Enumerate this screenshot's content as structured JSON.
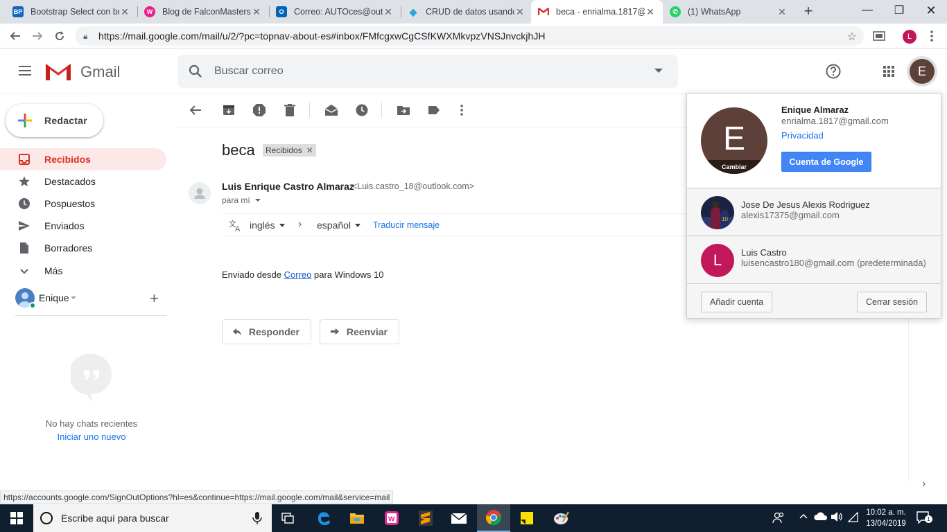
{
  "browser": {
    "tabs": [
      {
        "title": "Bootstrap Select con bu",
        "favicon": "BP",
        "favicon_color": "#1565c0"
      },
      {
        "title": "Blog de FalconMasters",
        "favicon": "W",
        "favicon_color": "#e91e8c"
      },
      {
        "title": "Correo: AUTOces@outl",
        "favicon": "O",
        "favicon_color": "#0364b8"
      },
      {
        "title": "CRUD de datos usando",
        "favicon": "◆",
        "favicon_color": "#29a9d8"
      },
      {
        "title": "beca - enrialma.1817@",
        "favicon": "M",
        "favicon_color": "#ffffff",
        "active": true
      },
      {
        "title": "(1) WhatsApp",
        "favicon": "✆",
        "favicon_color": "#25d366"
      }
    ],
    "url": "https://mail.google.com/mail/u/2/?pc=topnav-about-es#inbox/FMfcgxwCgCSfKWXMkvpzVNSJnvckjhJH",
    "profile_initial": "L",
    "status_url": "https://accounts.google.com/SignOutOptions?hl=es&continue=https://mail.google.com/mail&service=mail"
  },
  "gmail": {
    "brand": "Gmail",
    "search_placeholder": "Buscar correo",
    "user_initial": "E",
    "compose_label": "Redactar",
    "nav": [
      {
        "label": "Recibidos",
        "icon": "inbox-icon",
        "active": true
      },
      {
        "label": "Destacados",
        "icon": "star-icon"
      },
      {
        "label": "Pospuestos",
        "icon": "clock-icon"
      },
      {
        "label": "Enviados",
        "icon": "send-icon"
      },
      {
        "label": "Borradores",
        "icon": "draft-icon"
      },
      {
        "label": "Más",
        "icon": "chevron-down-icon"
      }
    ],
    "hangouts": {
      "user": "Enique",
      "no_chats": "No hay chats recientes",
      "start_new": "Iniciar uno nuevo"
    }
  },
  "message": {
    "subject": "beca",
    "label": "Recibidos",
    "sender_name": "Luis Enrique Castro Almaraz",
    "sender_email": "<Luis.castro_18@outlook.com>",
    "to": "para mí",
    "translate": {
      "from": "inglés",
      "to": "español",
      "action": "Traducir mensaje"
    },
    "body_prefix": "Enviado desde ",
    "body_link": "Correo",
    "body_suffix": " para Windows 10",
    "reply_label": "Responder",
    "forward_label": "Reenviar"
  },
  "account_popup": {
    "initial": "E",
    "change_label": "Cambiar",
    "name": "Enique Almaraz",
    "email": "enrialma.1817@gmail.com",
    "privacy": "Privacidad",
    "google_account_button": "Cuenta de Google",
    "other_accounts": [
      {
        "name": "Jose De Jesus Alexis Rodriguez",
        "email": "alexis17375@gmail.com"
      },
      {
        "name": "Luis Castro",
        "email": "luisencastro180@gmail.com (predeterminada)",
        "initial": "L"
      }
    ],
    "add_account": "Añadir cuenta",
    "sign_out": "Cerrar sesión"
  },
  "taskbar": {
    "search_placeholder": "Escribe aquí para buscar",
    "time": "10:02 a. m.",
    "date": "13/04/2019",
    "notification_count": "1"
  },
  "colors": {
    "gmail_red": "#d93025",
    "active_nav_bg": "#fce8e6",
    "google_blue": "#4285f4",
    "taskbar_bg": "#101f2f"
  }
}
